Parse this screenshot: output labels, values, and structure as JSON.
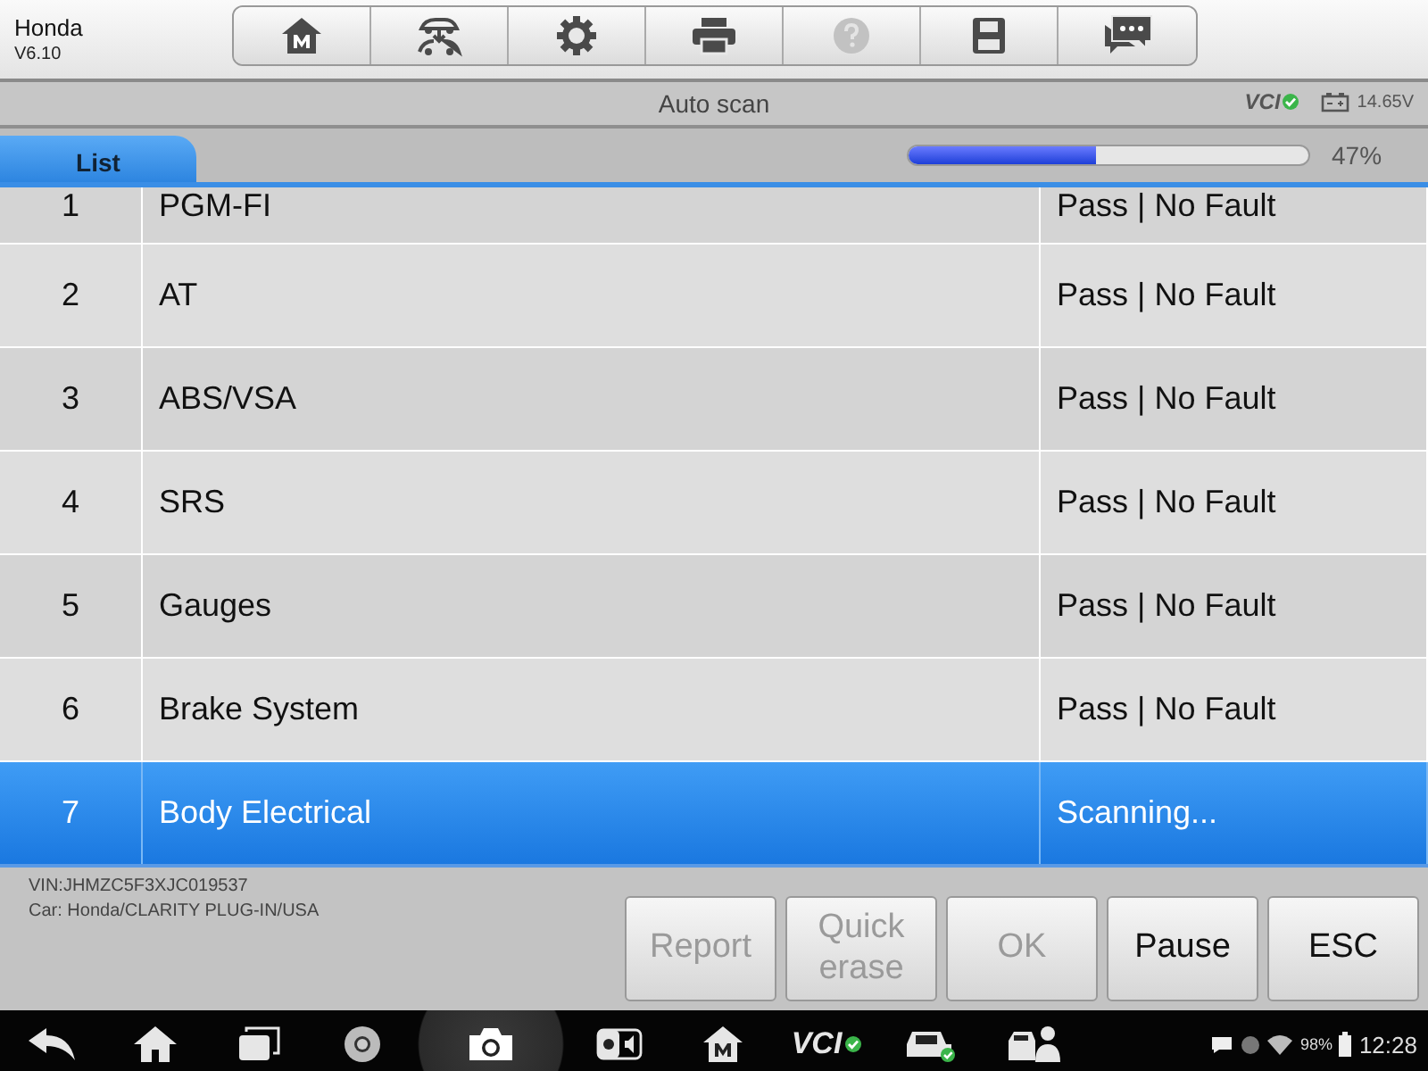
{
  "app": {
    "name": "Honda",
    "version": "V6.10"
  },
  "toolbar": [
    {
      "kind": "home",
      "disabled": false
    },
    {
      "kind": "vehicle",
      "disabled": false
    },
    {
      "kind": "settings",
      "disabled": false
    },
    {
      "kind": "print",
      "disabled": false
    },
    {
      "kind": "help",
      "disabled": true
    },
    {
      "kind": "save",
      "disabled": false
    },
    {
      "kind": "message",
      "disabled": false
    }
  ],
  "title": "Auto scan",
  "vci": {
    "label": "VCI",
    "connected": true
  },
  "voltage": "14.65V",
  "tabs": [
    {
      "label": "List",
      "selected": true
    }
  ],
  "progress": {
    "level": 0.47,
    "reading": "47%"
  },
  "rows": [
    {
      "number": "1",
      "system": "PGM-FI",
      "status": "Pass | No Fault",
      "selected": false
    },
    {
      "number": "2",
      "system": "AT",
      "status": "Pass | No Fault",
      "selected": false
    },
    {
      "number": "3",
      "system": "ABS/VSA",
      "status": "Pass | No Fault",
      "selected": false
    },
    {
      "number": "4",
      "system": "SRS",
      "status": "Pass | No Fault",
      "selected": false
    },
    {
      "number": "5",
      "system": "Gauges",
      "status": "Pass | No Fault",
      "selected": false
    },
    {
      "number": "6",
      "system": "Brake System",
      "status": "Pass | No Fault",
      "selected": false
    },
    {
      "number": "7",
      "system": "Body Electrical",
      "status": "Scanning...",
      "selected": true
    }
  ],
  "vehicle": {
    "vin": "VIN:JHMZC5F3XJC019537",
    "car": "Car: Honda/CLARITY PLUG-IN/USA"
  },
  "buttons": [
    {
      "label": "Report",
      "disabled": true
    },
    {
      "label": "Quick erase",
      "disabled": true
    },
    {
      "label": "OK",
      "disabled": true
    },
    {
      "label": "Pause",
      "disabled": false
    },
    {
      "label": "ESC",
      "disabled": false
    }
  ],
  "nav_bar": {
    "icons": [
      {
        "kind": "back",
        "selected": false
      },
      {
        "kind": "home",
        "selected": false
      },
      {
        "kind": "recent",
        "selected": false
      },
      {
        "kind": "browser",
        "selected": false
      },
      {
        "kind": "camera",
        "selected": true
      },
      {
        "kind": "brightness",
        "selected": false
      },
      {
        "kind": "m-home",
        "selected": false
      },
      {
        "kind": "vci",
        "label": "VCI",
        "selected": false
      },
      {
        "kind": "car",
        "selected": false
      },
      {
        "kind": "technician",
        "selected": false
      }
    ],
    "battery": "98%",
    "time": "12:28"
  }
}
